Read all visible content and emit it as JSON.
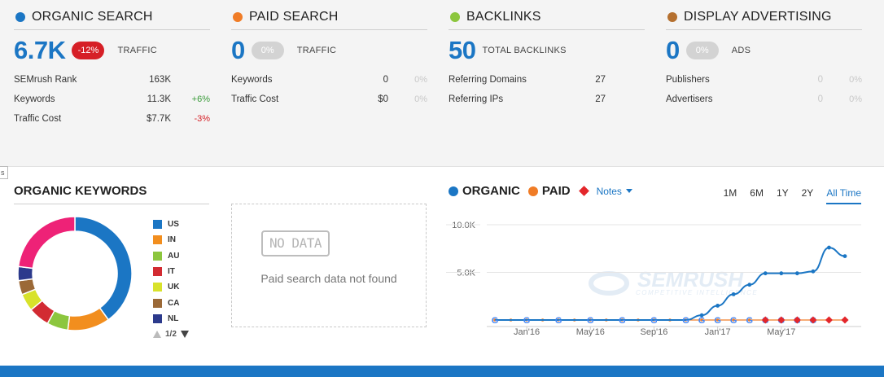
{
  "panels": [
    {
      "title": "ORGANIC SEARCH",
      "color": "#1b76c4",
      "big_value": "6.7K",
      "badge": "-12%",
      "badge_style": "red",
      "big_label": "TRAFFIC",
      "rows": [
        {
          "label": "SEMrush Rank",
          "value": "163K",
          "change": "",
          "change_style": ""
        },
        {
          "label": "Keywords",
          "value": "11.3K",
          "change": "+6%",
          "change_style": "pos"
        },
        {
          "label": "Traffic Cost",
          "value": "$7.7K",
          "change": "-3%",
          "change_style": "neg"
        }
      ]
    },
    {
      "title": "PAID SEARCH",
      "color": "#f07c26",
      "big_value": "0",
      "badge": "0%",
      "badge_style": "grey",
      "big_label": "TRAFFIC",
      "rows": [
        {
          "label": "Keywords",
          "value": "0",
          "change": "0%",
          "change_style": ""
        },
        {
          "label": "Traffic Cost",
          "value": "$0",
          "change": "0%",
          "change_style": ""
        }
      ]
    },
    {
      "title": "BACKLINKS",
      "color": "#8cc63e",
      "big_value": "50",
      "badge": "",
      "badge_style": "",
      "big_label": "TOTAL BACKLINKS",
      "rows": [
        {
          "label": "Referring Domains",
          "value": "27",
          "change": "",
          "change_style": ""
        },
        {
          "label": "Referring IPs",
          "value": "27",
          "change": "",
          "change_style": ""
        }
      ]
    },
    {
      "title": "DISPLAY ADVERTISING",
      "color": "#b5702f",
      "big_value": "0",
      "badge": "0%",
      "badge_style": "grey",
      "big_label": "ADS",
      "rows": [
        {
          "label": "Publishers",
          "value": "0",
          "value_style": "dim",
          "change": "0%",
          "change_style": ""
        },
        {
          "label": "Advertisers",
          "value": "0",
          "value_style": "dim",
          "change": "0%",
          "change_style": ""
        }
      ]
    }
  ],
  "edge_tab": "s",
  "organic_keywords": {
    "title": "ORGANIC KEYWORDS",
    "legend": [
      {
        "label": "US",
        "color": "#1b76c4",
        "value": 40
      },
      {
        "label": "IN",
        "color": "#f28e1e",
        "value": 12
      },
      {
        "label": "AU",
        "color": "#8cc63e",
        "value": 6
      },
      {
        "label": "IT",
        "color": "#d22b32",
        "value": 6
      },
      {
        "label": "UK",
        "color": "#d8e22b",
        "value": 5
      },
      {
        "label": "CA",
        "color": "#9b6937",
        "value": 4
      },
      {
        "label": "NL",
        "color": "#2c3a8c",
        "value": 4
      }
    ],
    "other_slice": {
      "color": "#ee2277",
      "value": 23
    },
    "pager": "1/2"
  },
  "no_data": {
    "stamp": "NO DATA",
    "message": "Paid search data not found"
  },
  "chart_header": {
    "organic_label": "ORGANIC",
    "organic_color": "#1b76c4",
    "paid_label": "PAID",
    "paid_color": "#f07c26",
    "notes_label": "Notes"
  },
  "ranges": [
    {
      "label": "1M",
      "active": false
    },
    {
      "label": "6M",
      "active": false
    },
    {
      "label": "1Y",
      "active": false
    },
    {
      "label": "2Y",
      "active": false
    },
    {
      "label": "All Time",
      "active": true
    }
  ],
  "chart_data": {
    "type": "line",
    "y_ticks": [
      "10.0K",
      "5.0K"
    ],
    "ylim": [
      0,
      10000
    ],
    "x_tick_labels": [
      "Jan'16",
      "May'16",
      "Sep'16",
      "Jan'17",
      "May'17"
    ],
    "x_tick_index": [
      2,
      6,
      10,
      14,
      18
    ],
    "series": [
      {
        "name": "ORGANIC",
        "color": "#1b76c4",
        "values": [
          0,
          0,
          0,
          0,
          0,
          0,
          0,
          0,
          0,
          0,
          0,
          0,
          0,
          500,
          1500,
          2700,
          3700,
          4900,
          4900,
          4900,
          5100,
          7600,
          6700
        ]
      },
      {
        "name": "PAID",
        "color": "#f07c26",
        "values": [
          0,
          0,
          0,
          0,
          0,
          0,
          0,
          0,
          0,
          0,
          0,
          0,
          0,
          0,
          0,
          0,
          0,
          0,
          0,
          0,
          0,
          0,
          0
        ]
      }
    ],
    "google_markers": [
      0,
      2,
      4,
      6,
      8,
      10,
      12,
      13,
      14,
      15,
      16,
      17,
      18,
      19,
      20
    ],
    "notes_markers": [
      17,
      18,
      19,
      20,
      21,
      22
    ]
  },
  "watermark": {
    "brand": "SEMRUSH",
    "tagline": "COMPETITIVE INTELLIGENCE"
  }
}
